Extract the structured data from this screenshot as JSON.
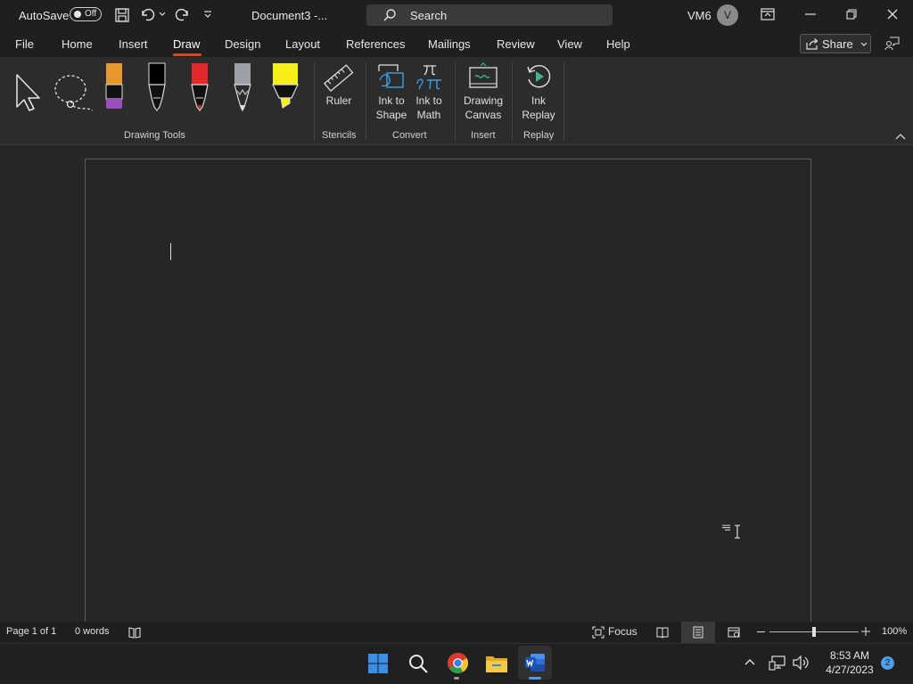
{
  "titlebar": {
    "autosave_label": "AutoSave",
    "autosave_state": "Off",
    "document_title": "Document3  -...",
    "search_placeholder": "Search",
    "user_initials": "VM6",
    "avatar_letter": "V"
  },
  "menu": {
    "items": [
      "File",
      "Home",
      "Insert",
      "Draw",
      "Design",
      "Layout",
      "References",
      "Mailings",
      "Review",
      "View",
      "Help"
    ],
    "active": "Draw",
    "share_label": "Share"
  },
  "ribbon": {
    "groups": {
      "drawing_tools": "Drawing Tools",
      "stencils": "Stencils",
      "convert": "Convert",
      "insert": "Insert",
      "replay": "Replay"
    },
    "buttons": {
      "ruler": "Ruler",
      "ink_to_shape_1": "Ink to",
      "ink_to_shape_2": "Shape",
      "ink_to_math_1": "Ink to",
      "ink_to_math_2": "Math",
      "drawing_canvas_1": "Drawing",
      "drawing_canvas_2": "Canvas",
      "ink_replay_1": "Ink",
      "ink_replay_2": "Replay"
    },
    "pen_colors": {
      "pen1_top": "#e8962e",
      "pen1_band": "#9b4fc0",
      "pen2": "#000000",
      "pen3": "#e22828",
      "pencil": "#9aa0a6",
      "highlighter": "#f7ee1a"
    }
  },
  "statusbar": {
    "page_info": "Page 1 of 1",
    "word_count": "0 words",
    "focus_label": "Focus",
    "zoom_level": "100%",
    "zoom_fraction": 0.5
  },
  "taskbar": {
    "time": "8:53 AM",
    "date": "4/27/2023",
    "notification_count": "2",
    "apps": [
      "windows-start-icon",
      "search-icon",
      "chrome-icon",
      "file-explorer-icon",
      "word-icon"
    ]
  }
}
